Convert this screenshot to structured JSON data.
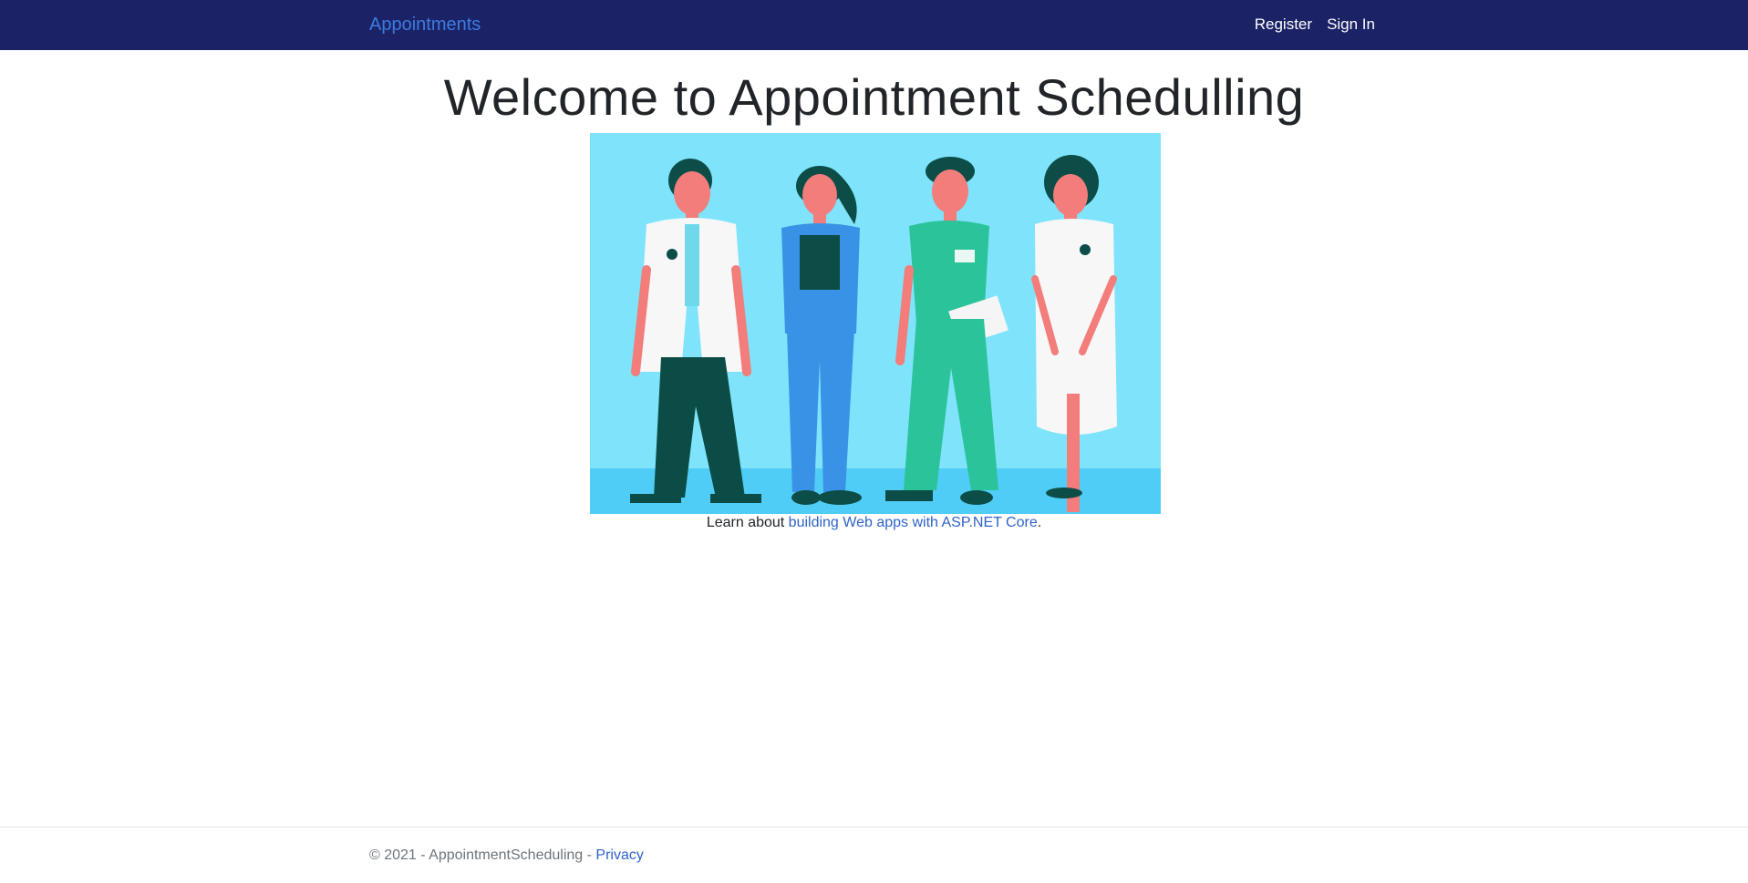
{
  "navbar": {
    "brand": "Appointments",
    "links": [
      {
        "label": "Register"
      },
      {
        "label": "Sign In"
      }
    ]
  },
  "main": {
    "title": "Welcome to Appointment Schedulling",
    "learn_prefix": "Learn about ",
    "learn_link": "building Web apps with ASP.NET Core",
    "learn_suffix": "."
  },
  "footer": {
    "copyright": "© 2021 - AppointmentScheduling - ",
    "privacy_link": "Privacy"
  },
  "colors": {
    "navbar_bg": "#1b2366",
    "brand": "#3d7be0",
    "link": "#2d63c8",
    "hero_bg": "#7fe4fb"
  }
}
